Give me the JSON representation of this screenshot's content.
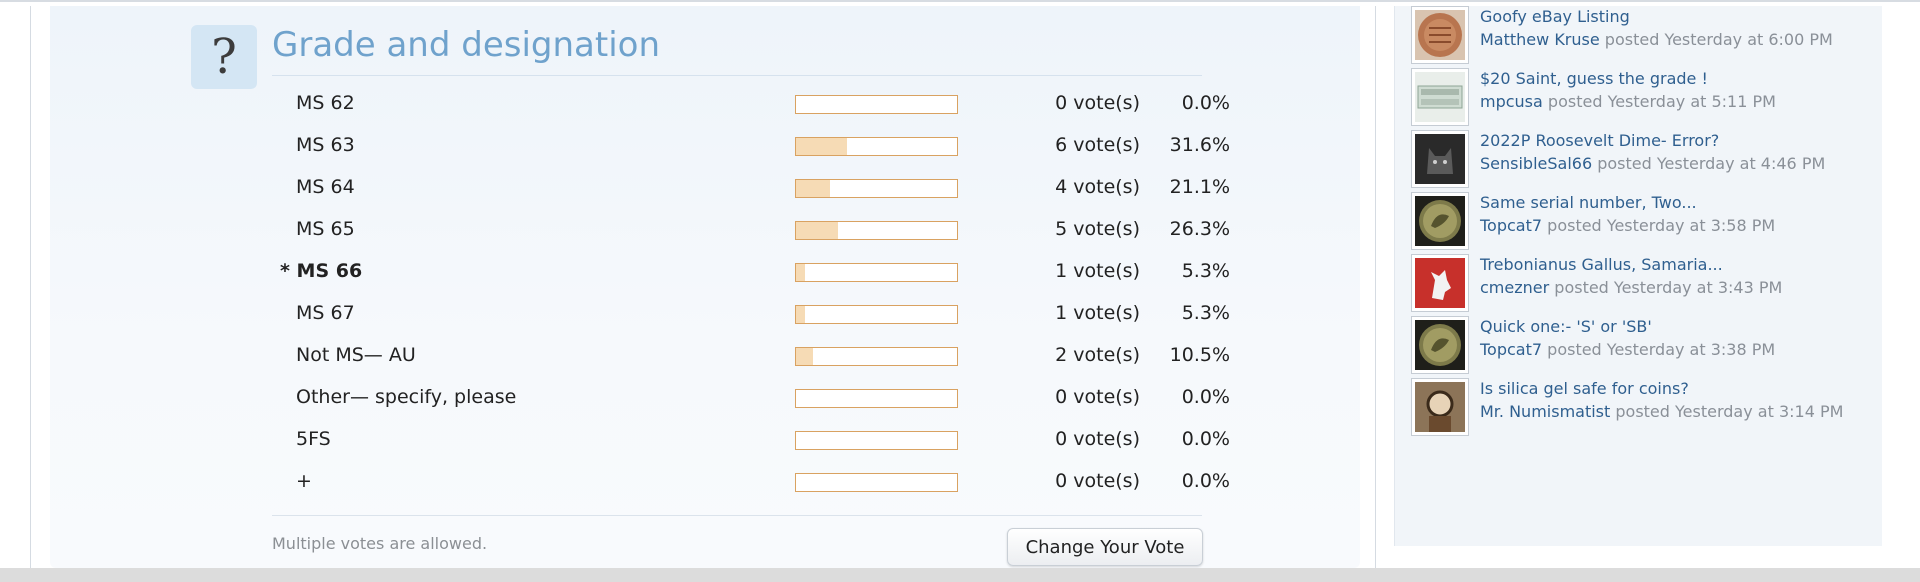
{
  "poll": {
    "icon": "question-mark-icon",
    "icon_glyph": "?",
    "title": "Grade and designation",
    "options": [
      {
        "label": "MS 62",
        "votes": "0 vote(s)",
        "percent": "0.0%",
        "fraction": 0.0,
        "selected": false
      },
      {
        "label": "MS 63",
        "votes": "6 vote(s)",
        "percent": "31.6%",
        "fraction": 0.316,
        "selected": false
      },
      {
        "label": "MS 64",
        "votes": "4 vote(s)",
        "percent": "21.1%",
        "fraction": 0.211,
        "selected": false
      },
      {
        "label": "MS 65",
        "votes": "5 vote(s)",
        "percent": "26.3%",
        "fraction": 0.263,
        "selected": false
      },
      {
        "label": "* MS 66",
        "votes": "1 vote(s)",
        "percent": "5.3%",
        "fraction": 0.053,
        "selected": true
      },
      {
        "label": "MS 67",
        "votes": "1 vote(s)",
        "percent": "5.3%",
        "fraction": 0.053,
        "selected": false
      },
      {
        "label": "Not MS— AU",
        "votes": "2 vote(s)",
        "percent": "10.5%",
        "fraction": 0.105,
        "selected": false
      },
      {
        "label": "Other— specify, please",
        "votes": "0 vote(s)",
        "percent": "0.0%",
        "fraction": 0.0,
        "selected": false
      },
      {
        "label": "5FS",
        "votes": "0 vote(s)",
        "percent": "0.0%",
        "fraction": 0.0,
        "selected": false
      },
      {
        "label": "+",
        "votes": "0 vote(s)",
        "percent": "0.0%",
        "fraction": 0.0,
        "selected": false
      }
    ],
    "multiple_note": "Multiple votes are allowed.",
    "change_vote_label": "Change Your Vote"
  },
  "sidebar": {
    "items": [
      {
        "title": "Goofy eBay Listing",
        "author": "Matthew Kruse",
        "posted": "posted Yesterday at 6:00 PM",
        "thumb": "canada-coin-thumb"
      },
      {
        "title": "$20 Saint, guess the grade !",
        "author": "mpcusa",
        "posted": "posted Yesterday at 5:11 PM",
        "thumb": "banknote-thumb"
      },
      {
        "title": "2022P Roosevelt Dime- Error?",
        "author": "SensibleSal66",
        "posted": "posted Yesterday at 4:46 PM",
        "thumb": "dark-cat-thumb"
      },
      {
        "title": "Same serial number, Two...",
        "author": "Topcat7",
        "posted": "posted Yesterday at 3:58 PM",
        "thumb": "ancient-coin-thumb"
      },
      {
        "title": "Trebonianus Gallus, Samaria...",
        "author": "cmezner",
        "posted": "posted Yesterday at 3:43 PM",
        "thumb": "red-lion-crest-thumb"
      },
      {
        "title": "Quick one:- 'S' or 'SB'",
        "author": "Topcat7",
        "posted": "posted Yesterday at 3:38 PM",
        "thumb": "ancient-coin-thumb"
      },
      {
        "title": "Is silica gel safe for coins?",
        "author": "Mr. Numismatist",
        "posted": "posted Yesterday at 3:14 PM",
        "thumb": "person-magnifier-thumb"
      }
    ]
  },
  "colors": {
    "title_blue": "#6fa2cc",
    "link_blue": "#2f5f8f",
    "bar_border": "#d9a261",
    "bar_fill": "#f6dbb5",
    "icon_bg": "#d4e6f4"
  }
}
